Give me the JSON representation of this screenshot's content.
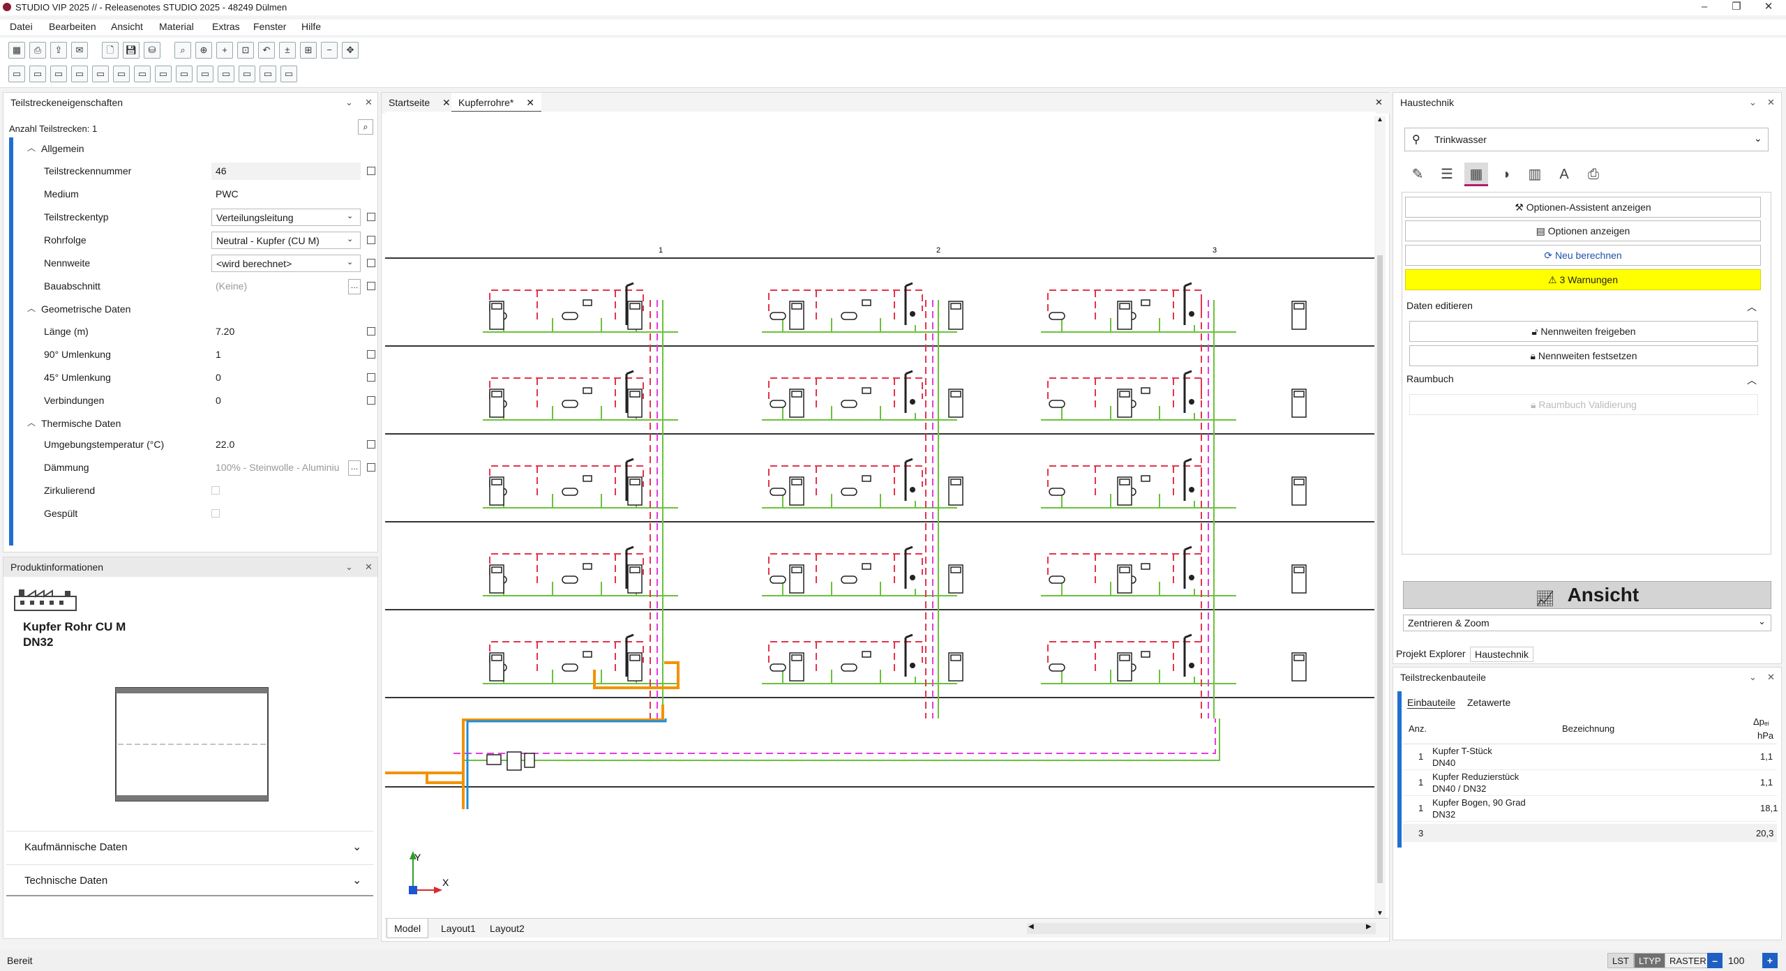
{
  "window": {
    "title": "STUDIO VIP 2025 // - Releasenotes STUDIO 2025 - 48249 Dülmen"
  },
  "menu": [
    "Datei",
    "Bearbeiten",
    "Ansicht",
    "Material",
    "Extras",
    "Fenster",
    "Hilfe"
  ],
  "left_panel": {
    "title": "Teilstreckeneigenschaften",
    "count_label": "Anzahl Teilstrecken: 1",
    "sections": {
      "general": "Allgemein",
      "geometry": "Geometrische Daten",
      "thermal": "Thermische Daten"
    },
    "rows": {
      "nummer": {
        "label": "Teilstreckennummer",
        "value": "46"
      },
      "medium": {
        "label": "Medium",
        "value": "PWC"
      },
      "typ": {
        "label": "Teilstreckentyp",
        "value": "Verteilungsleitung"
      },
      "rohrfolge": {
        "label": "Rohrfolge",
        "value": "Neutral - Kupfer (CU M)"
      },
      "nennweite": {
        "label": "Nennweite",
        "value": "<wird berechnet>"
      },
      "bauabschnitt": {
        "label": "Bauabschnitt",
        "value": "(Keine)"
      },
      "laenge": {
        "label": "Länge (m)",
        "value": "7.20"
      },
      "umlenkung90": {
        "label": "90° Umlenkung",
        "value": "1"
      },
      "umlenkung45": {
        "label": "45° Umlenkung",
        "value": "0"
      },
      "verbindungen": {
        "label": "Verbindungen",
        "value": "0"
      },
      "temp": {
        "label": "Umgebungstemperatur (°C)",
        "value": "22.0"
      },
      "daemmung": {
        "label": "Dämmung",
        "value": "100% - Steinwolle - Aluminiu"
      },
      "zirkulierend": {
        "label": "Zirkulierend"
      },
      "gespuelt": {
        "label": "Gespült"
      }
    }
  },
  "product_panel": {
    "title": "Produktinformationen",
    "product_name": "Kupfer Rohr CU M",
    "product_size": "DN32",
    "sections": [
      "Kaufmännische Daten",
      "Technische Daten"
    ]
  },
  "doc_tabs": [
    {
      "label": "Startseite"
    },
    {
      "label": "Kupferrohre*"
    }
  ],
  "layout_tabs": [
    "Model",
    "Layout1",
    "Layout2"
  ],
  "grid_labels": [
    "1",
    "2",
    "3"
  ],
  "ucs": {
    "y": "Y",
    "x": "X"
  },
  "right_panel": {
    "title": "Haustechnik",
    "trade": "Trinkwasser",
    "buttons": {
      "assistant": "Optionen-Assistent anzeigen",
      "options": "Optionen anzeigen",
      "recalc": "Neu berechnen",
      "warnings": "3 Warnungen"
    },
    "edit_section": "Daten editieren",
    "edit_buttons": [
      "Nennweiten freigeben",
      "Nennweiten festsetzen"
    ],
    "raumbuch_section": "Raumbuch",
    "raumbuch_button": "Raumbuch Validierung",
    "view_button": "Ansicht",
    "view_select": "Zentrieren & Zoom",
    "bottom_tabs": [
      "Projekt Explorer",
      "Haustechnik"
    ],
    "warning_color": "#ffff00"
  },
  "components_panel": {
    "title": "Teilstreckenbauteile",
    "tabs": [
      "Einbauteile",
      "Zetawerte"
    ],
    "columns": {
      "anz": "Anz.",
      "bez": "Bezeichnung",
      "dp": "Δpₑᵢ",
      "unit": "hPa"
    },
    "rows": [
      {
        "anz": "1",
        "name": "Kupfer T-Stück",
        "size": "DN40",
        "dp": "1,1"
      },
      {
        "anz": "1",
        "name": "Kupfer Reduzierstück",
        "size": "DN40 / DN32",
        "dp": "1,1"
      },
      {
        "anz": "1",
        "name": "Kupfer Bogen, 90 Grad",
        "size": "DN32",
        "dp": "18,1"
      }
    ],
    "total": {
      "anz": "3",
      "dp": "20,3"
    }
  },
  "statusbar": {
    "text": "Bereit",
    "buttons": [
      "LST",
      "LTYP",
      "RASTER"
    ],
    "zoom": "100"
  }
}
